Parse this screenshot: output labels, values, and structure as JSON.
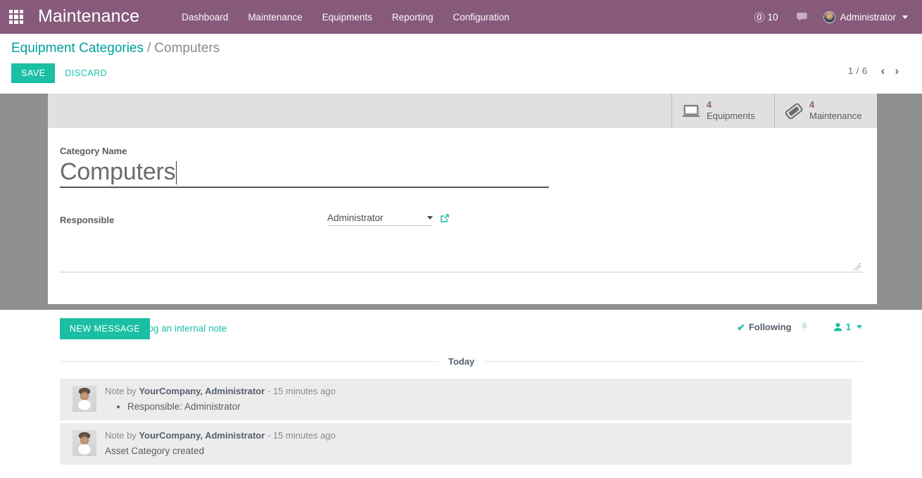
{
  "navbar": {
    "apps_icon": "apps-grid-icon",
    "brand": "Maintenance",
    "menu": [
      {
        "label": "Dashboard"
      },
      {
        "label": "Maintenance"
      },
      {
        "label": "Equipments"
      },
      {
        "label": "Reporting"
      },
      {
        "label": "Configuration"
      }
    ],
    "mentions": {
      "icon": "at-icon",
      "count": "10"
    },
    "chat_icon": "chat-bubble-icon",
    "user": {
      "name": "Administrator",
      "avatar": "user-avatar",
      "caret": "chevron-down-icon"
    },
    "background_color": "#875A7B"
  },
  "control_panel": {
    "breadcrumb": {
      "parent": "Equipment Categories",
      "separator": "/",
      "current": "Computers"
    },
    "save_label": "SAVE",
    "discard_label": "DISCARD",
    "pager": {
      "count": "1 / 6",
      "prev_icon": "chevron-left-icon",
      "next_icon": "chevron-right-icon"
    },
    "accent_color": "#1BBFA3",
    "link_color": "#00A09D"
  },
  "form": {
    "stat_buttons": [
      {
        "icon": "laptop-icon",
        "value": "4",
        "label": "Equipments"
      },
      {
        "icon": "ticket-icon",
        "value": "4",
        "label": "Maintenance"
      }
    ],
    "category_name": {
      "label": "Category Name",
      "value": "Computers",
      "placeholder": "Category Name"
    },
    "responsible": {
      "label": "Responsible",
      "value": "Administrator",
      "placeholder": "Responsible",
      "dropdown_icon": "chevron-down-icon",
      "external_link_icon": "external-link-icon"
    },
    "comment": {
      "value": "",
      "placeholder": ""
    },
    "backdrop_color": "#8F8F8F",
    "stat_bar_color": "#E0E0DE"
  },
  "chatter": {
    "new_message_label": "NEW MESSAGE",
    "internal_note_label": "Log an internal note",
    "following": {
      "icon": "check-icon",
      "label": "Following"
    },
    "bell_icon": "bell-icon",
    "followers": {
      "icon": "user-icon",
      "count": "1",
      "caret": "chevron-down-icon"
    },
    "day_separator": "Today",
    "messages": [
      {
        "avatar": "user-avatar",
        "prefix": "Note by ",
        "author": "YourCompany, Administrator",
        "timestamp": " - 15 minutes ago",
        "bullets": [
          "Responsible: Administrator"
        ],
        "text": ""
      },
      {
        "avatar": "user-avatar",
        "prefix": "Note by ",
        "author": "YourCompany, Administrator",
        "timestamp": " - 15 minutes ago",
        "bullets": [],
        "text": "Asset Category created"
      }
    ]
  }
}
